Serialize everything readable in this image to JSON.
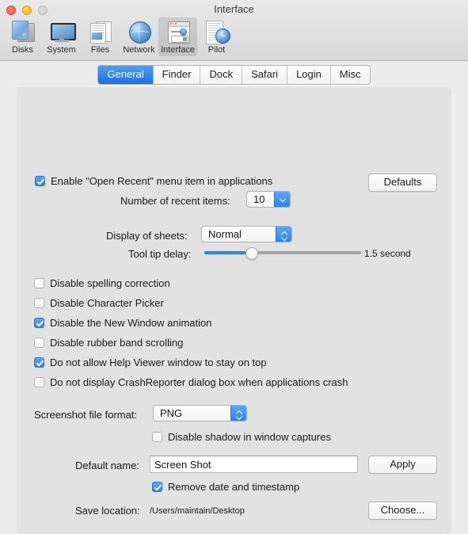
{
  "window": {
    "title": "Interface",
    "traffic_lights": [
      "close-button",
      "minimize-button",
      "zoom-button"
    ]
  },
  "toolbar": {
    "items": [
      {
        "label": "Disks",
        "icon": "hard-disk-icon",
        "selected": false
      },
      {
        "label": "System",
        "icon": "display-icon",
        "selected": false
      },
      {
        "label": "Files",
        "icon": "documents-icon",
        "selected": false
      },
      {
        "label": "Network",
        "icon": "globe-icon",
        "selected": false
      },
      {
        "label": "Interface",
        "icon": "preferences-window-icon",
        "selected": true
      },
      {
        "label": "Pilot",
        "icon": "clock-list-icon",
        "selected": false
      }
    ]
  },
  "tabs": [
    {
      "label": "General",
      "active": true
    },
    {
      "label": "Finder",
      "active": false
    },
    {
      "label": "Dock",
      "active": false
    },
    {
      "label": "Safari",
      "active": false
    },
    {
      "label": "Login",
      "active": false
    },
    {
      "label": "Misc",
      "active": false
    }
  ],
  "general": {
    "open_recent": {
      "label": "Enable \"Open Recent\" menu item in applications",
      "checked": true
    },
    "defaults_button": "Defaults",
    "recent_items": {
      "label": "Number of recent items:",
      "value": "10"
    },
    "display_sheets": {
      "label": "Display of sheets:",
      "value": "Normal"
    },
    "tooltip_delay": {
      "label": "Tool tip delay:",
      "value_text": "1.5 second",
      "percent": 30
    },
    "checkboxes": [
      {
        "label": "Disable spelling correction",
        "checked": false
      },
      {
        "label": "Disable Character Picker",
        "checked": false
      },
      {
        "label": "Disable the New Window animation",
        "checked": true
      },
      {
        "label": "Disable rubber band scrolling",
        "checked": false
      },
      {
        "label": "Do not allow Help Viewer window to stay on top",
        "checked": true
      },
      {
        "label": "Do not display CrashReporter dialog box when applications crash",
        "checked": false
      }
    ],
    "screenshot_format": {
      "label": "Screenshot file format:",
      "value": "PNG"
    },
    "disable_shadow": {
      "label": "Disable shadow in window captures",
      "checked": false
    },
    "default_name": {
      "label": "Default name:",
      "value": "Screen Shot"
    },
    "apply_button": "Apply",
    "remove_timestamp": {
      "label": "Remove date and timestamp",
      "checked": true
    },
    "save_location": {
      "label": "Save location:",
      "value": "/Users/maintain/Desktop"
    },
    "choose_button": "Choose..."
  }
}
